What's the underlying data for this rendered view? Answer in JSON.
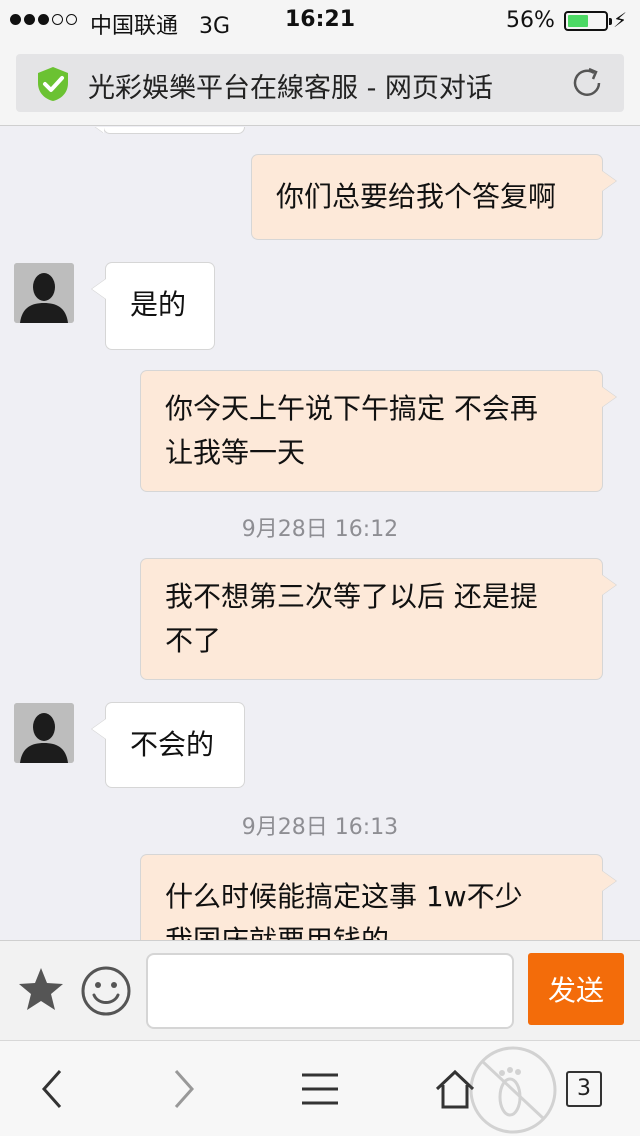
{
  "status_bar": {
    "carrier": "中国联通",
    "network": "3G",
    "time": "16:21",
    "battery_percent": "56%",
    "battery_level": 0.56
  },
  "address_bar": {
    "title": "光彩娛樂平台在線客服 - 网页对话",
    "secure_icon": "shield-check-icon",
    "reload_icon": "reload-icon",
    "secure_color": "#6bc232"
  },
  "chat": {
    "messages": [
      {
        "dir": "out",
        "text": "你们总要给我个答复啊"
      },
      {
        "dir": "in",
        "text": "是的"
      },
      {
        "dir": "out",
        "lines": [
          "你今天上午说下午搞定 不会再",
          "让我等一天"
        ]
      },
      {
        "timestamp": "9月28日 16:12"
      },
      {
        "dir": "out",
        "lines": [
          "我不想第三次等了以后 还是提",
          "不了"
        ]
      },
      {
        "dir": "in",
        "text": "不会的"
      },
      {
        "timestamp": "9月28日 16:13"
      },
      {
        "dir": "out",
        "lines": [
          "什么时候能搞定这事 1w不少",
          "我国庆就要用钱的"
        ]
      }
    ]
  },
  "input_bar": {
    "message_value": "",
    "send_label": "发送",
    "send_color": "#f36c0a"
  },
  "toolbar": {
    "tab_count": "3",
    "icons": [
      "back-icon",
      "forward-icon",
      "menu-icon",
      "home-icon",
      "footprint-icon",
      "tabs-icon"
    ]
  }
}
